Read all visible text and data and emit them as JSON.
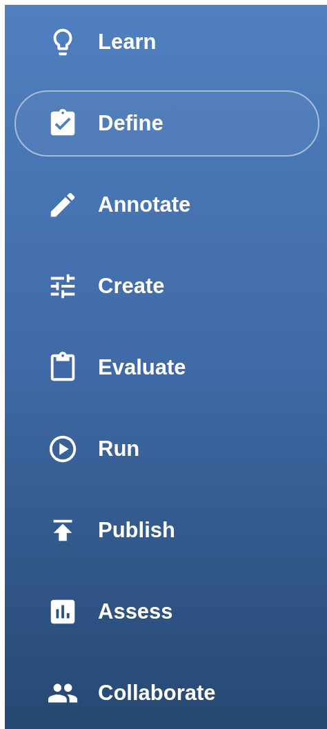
{
  "nav": [
    {
      "label": "Learn",
      "selected": false
    },
    {
      "label": "Define",
      "selected": true
    },
    {
      "label": "Annotate",
      "selected": false
    },
    {
      "label": "Create",
      "selected": false
    },
    {
      "label": "Evaluate",
      "selected": false
    },
    {
      "label": "Run",
      "selected": false
    },
    {
      "label": "Publish",
      "selected": false
    },
    {
      "label": "Assess",
      "selected": false
    },
    {
      "label": "Collaborate",
      "selected": false
    }
  ]
}
